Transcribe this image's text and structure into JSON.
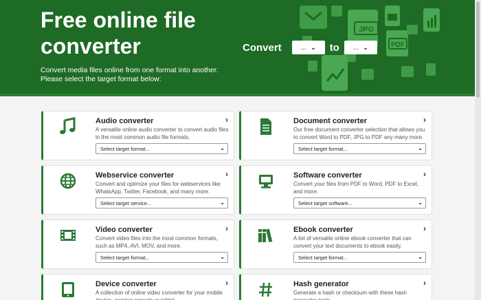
{
  "hero": {
    "title": "Free online file converter",
    "subtitle": "Convert media files online from one format into another. Please select the target format below:",
    "convert_label": "Convert",
    "to_label": "to",
    "from_value": "...",
    "to_value": "...",
    "bg_color": "#1e6b26"
  },
  "cards": [
    {
      "title": "Audio converter",
      "desc": "A versatile online audio converter to convert audio files in the most common audio file formats.",
      "select": "Select target format...",
      "icon": "music-note-icon"
    },
    {
      "title": "Document converter",
      "desc": "Our free document converter selection that allows you to convert Word to PDF, JPG to PDF any many more.",
      "select": "Select target format...",
      "icon": "document-icon"
    },
    {
      "title": "Webservice converter",
      "desc": "Convert and optimize your files for webservices like WhatsApp, Twitter, Facebook, and many more.",
      "select": "Select target service...",
      "icon": "globe-icon"
    },
    {
      "title": "Software converter",
      "desc": "Convert your files from PDF to Word, PDF to Excel, and more.",
      "select": "Select target software...",
      "icon": "monitor-icon"
    },
    {
      "title": "Video converter",
      "desc": "Convert video files into the most common formats, such as MP4, AVI, MOV, and more.",
      "select": "Select target format...",
      "icon": "film-icon"
    },
    {
      "title": "Ebook converter",
      "desc": "A list of versatile online ebook converter that can convert your text documents to ebook easily.",
      "select": "Select target format...",
      "icon": "books-icon"
    },
    {
      "title": "Device converter",
      "desc": "A collection of online video converter for your mobile device, gaming console or tablet.",
      "select": "",
      "icon": "tablet-icon"
    },
    {
      "title": "Hash generator",
      "desc": "Generate a hash or checksum with these hash generator tools.",
      "select": "",
      "icon": "hash-icon"
    }
  ],
  "deco_labels": {
    "jpg": "JPG",
    "pdf": "PDF"
  },
  "accent_color": "#2b7a34"
}
